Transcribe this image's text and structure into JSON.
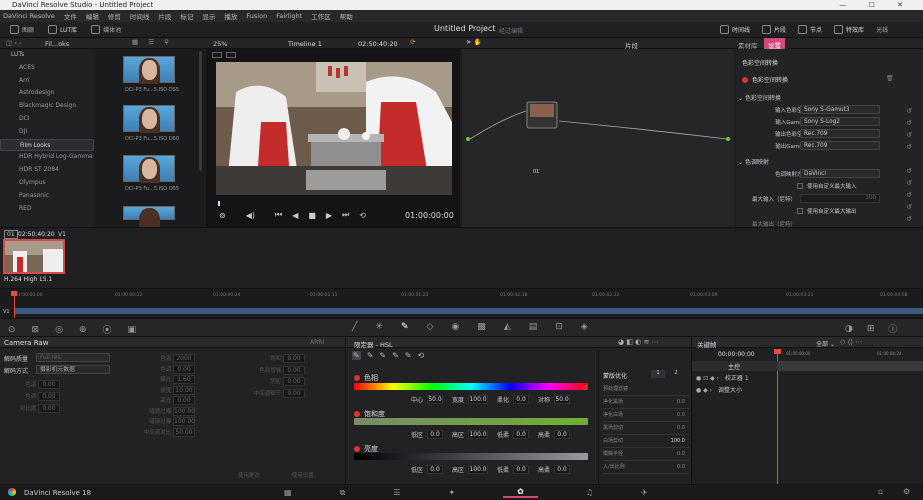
{
  "window": {
    "title": "DaVinci Resolve Studio - Untitled Project"
  },
  "menu": [
    "DaVinci Resolve",
    "文件",
    "编辑",
    "修剪",
    "时间线",
    "片段",
    "标记",
    "显示",
    "播放",
    "Fusion",
    "Fairlight",
    "工作区",
    "帮助"
  ],
  "topbar": {
    "left": [
      {
        "icon": "media-icon",
        "label": "图廊"
      },
      {
        "icon": "lut-icon",
        "label": "LUT库"
      },
      {
        "icon": "media-pool-icon",
        "label": "媒体池"
      }
    ],
    "project_title": "Untitled Project",
    "project_status": "经过编辑",
    "right": [
      {
        "icon": "timeline-icon",
        "label": "时间线"
      },
      {
        "icon": "clips-icon",
        "label": "片段"
      },
      {
        "icon": "nodes-icon",
        "label": "节点"
      },
      {
        "icon": "effects-icon",
        "label": "特效库"
      },
      {
        "label": "光线"
      }
    ]
  },
  "subbar": {
    "lut_folder": "Fil...oks",
    "zoom": "25%",
    "timeline": "Timeline 1",
    "timecode": "02:50:40:20",
    "clip_mode": "片段",
    "inspector_tabs": [
      "素材库",
      "设置"
    ]
  },
  "lut_tree": {
    "root": "LUTs",
    "items": [
      "ACES",
      "Arri",
      "Astrodesign",
      "Blackmagic Design",
      "DCI",
      "DJI",
      "Film Looks",
      "HDR Hybrid Log-Gamma",
      "HDR ST 2084",
      "Olympus",
      "Panasonic",
      "RED"
    ],
    "selected": "Film Looks"
  },
  "thumbnails": [
    {
      "label": "DCI-P3 Fu...5.ISO DS5"
    },
    {
      "label": "DCI-P3 Fu...5.ISO D60"
    },
    {
      "label": "DCI-P3 Fu...5.ISO D65"
    },
    {
      "label": ""
    }
  ],
  "viewer": {
    "timecode": "01:00:00:00"
  },
  "node": {
    "label": "01"
  },
  "inspector": {
    "header": "色彩空间转换",
    "plugin": "色彩空间转换",
    "section1": "色彩空间转换",
    "rows1": [
      {
        "label": "输入色彩空间",
        "value": "Sony S-Gamut3"
      },
      {
        "label": "输入Gamma",
        "value": "Sony S-Log2"
      },
      {
        "label": "输出色彩空间",
        "value": "Rec.709"
      },
      {
        "label": "输出Gamma",
        "value": "Rec.709"
      }
    ],
    "section2": "色调映射",
    "tone_label": "色调映射方式",
    "tone_value": "DaVinci",
    "check1": "使用自定义最大输入",
    "max_in_label": "最大输入（尼特）",
    "max_in_value": "100",
    "check2": "使用自定义最大输出",
    "max_out_label": "最大输出（尼特）"
  },
  "clipstrip": {
    "index": "01",
    "timecode": "02:50:40:20",
    "track": "V1",
    "codec": "H.264 High L5.1"
  },
  "ruler": [
    "01:00:00:00",
    "01:00:00:12",
    "01:00:00:24",
    "01:00:01:11",
    "01:00:01:23",
    "01:00:02:10",
    "01:00:02:22",
    "01:00:03:09",
    "01:00:03:21",
    "01:00:04:08"
  ],
  "track_label": "V1",
  "camera_raw": {
    "title": "Camera Raw",
    "badge": "ARRI",
    "decode_quality": {
      "label": "解码质量",
      "value": "Full res."
    },
    "decode_method": {
      "label": "解码方式",
      "value": "摄影机元数据"
    },
    "left_fields": [
      {
        "label": "色温",
        "value": "0.00"
      },
      {
        "label": "色调",
        "value": "0.00"
      },
      {
        "label": "对比度",
        "value": "0.00"
      }
    ],
    "mid_fields": [
      {
        "label": "色温",
        "value": "2000"
      },
      {
        "label": "色调",
        "value": "0.00"
      },
      {
        "label": "曝光",
        "value": "1.60"
      },
      {
        "label": "锐度",
        "value": "10.00"
      },
      {
        "label": "高光",
        "value": "0.00"
      },
      {
        "label": "暗调过曝",
        "value": "100.00"
      },
      {
        "label": "暗部过曝",
        "value": "100.00"
      },
      {
        "label": "中间调对比",
        "value": "50.00"
      }
    ],
    "right_fields": [
      {
        "label": "饱和",
        "value": "0.00"
      },
      {
        "label": "色彩增强",
        "value": "0.00"
      },
      {
        "label": "阴影",
        "value": "0.00"
      },
      {
        "label": "中间调细节",
        "value": "0.00"
      }
    ],
    "footer": [
      "使用更改",
      "使用设置"
    ]
  },
  "qualifier": {
    "title": "限定器 - HSL",
    "hue": {
      "label": "色相",
      "fields": [
        {
          "label": "中心",
          "value": "50.0"
        },
        {
          "label": "宽度",
          "value": "100.0"
        },
        {
          "label": "柔化",
          "value": "0.0"
        },
        {
          "label": "对称",
          "value": "50.0"
        }
      ]
    },
    "sat": {
      "label": "饱和度",
      "fields": [
        {
          "label": "低区",
          "value": "0.0"
        },
        {
          "label": "高区",
          "value": "100.0"
        },
        {
          "label": "低柔",
          "value": "0.0"
        },
        {
          "label": "高柔",
          "value": "0.0"
        }
      ]
    },
    "lum": {
      "label": "亮度",
      "fields": [
        {
          "label": "低区",
          "value": "0.0"
        },
        {
          "label": "高区",
          "value": "100.0"
        },
        {
          "label": "低柔",
          "value": "0.0"
        },
        {
          "label": "高柔",
          "value": "0.0"
        }
      ]
    },
    "matte": {
      "title": "蒙版优化",
      "pages": [
        "1",
        "2"
      ],
      "rows": [
        {
          "label": "预处理滤镜",
          "value": ""
        },
        {
          "label": "净化黑场",
          "value": "0.0"
        },
        {
          "label": "净化白场",
          "value": "0.0"
        },
        {
          "label": "黑场剪切",
          "value": "0.0"
        },
        {
          "label": "白场剪切",
          "value": "100.0"
        },
        {
          "label": "模糊半径",
          "value": "0.0"
        },
        {
          "label": "入/出比例",
          "value": "0.0"
        }
      ]
    }
  },
  "keyframes": {
    "title": "关键帧",
    "filter": "全部",
    "timecode": "00:00:00:00",
    "end_tc": "01:00:04:24",
    "mid_tc": "01:00:00:00",
    "tracks": [
      "主控",
      "校正器 1",
      "调整大小"
    ]
  },
  "statusbar": {
    "app": "DaVinci Resolve 18",
    "pages": [
      "media-page-icon",
      "cut-page-icon",
      "edit-page-icon",
      "fusion-page-icon",
      "color-page-icon",
      "fairlight-page-icon",
      "deliver-page-icon"
    ],
    "active_page": "color-page-icon"
  },
  "colors": {
    "accent": "#e64b3c",
    "active_tab": "#d24a7a"
  }
}
